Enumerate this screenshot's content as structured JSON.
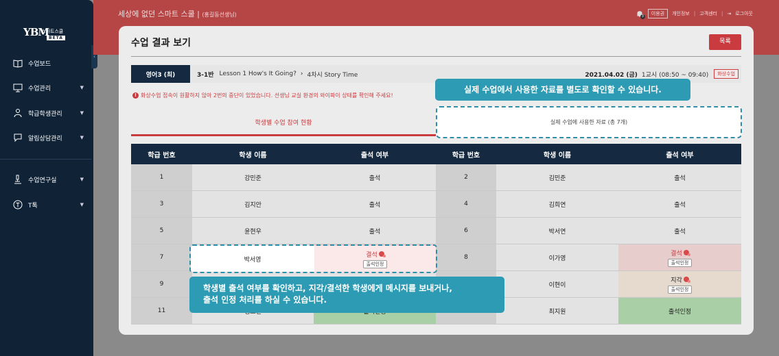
{
  "sidebar": {
    "logo_mark": "YBM",
    "brand": "스마트스쿨",
    "beta": "BETA",
    "collapse_icon": "chevron-left-icon",
    "items": [
      {
        "label": "수업보드",
        "icon": "book-icon",
        "has_arrow": false
      },
      {
        "label": "수업관리",
        "icon": "monitor-icon",
        "has_arrow": true
      },
      {
        "label": "학급학생관리",
        "icon": "users-icon",
        "has_arrow": true
      },
      {
        "label": "알림상담관리",
        "icon": "chat-icon",
        "has_arrow": true
      },
      {
        "label": "수업연구실",
        "icon": "microscope-icon",
        "has_arrow": true
      },
      {
        "label": "T톡",
        "icon": "t-circle-icon",
        "has_arrow": true
      }
    ]
  },
  "topbar": {
    "title": "세상에 없던 스마트 스쿨 |",
    "teacher": "(홍길동선생님)",
    "notif_count": "3",
    "user_button": "이용권",
    "links": [
      "개인정보",
      "고객센터"
    ],
    "logout": "로그아웃"
  },
  "page": {
    "title": "수업 결과 보기",
    "list_button": "목록"
  },
  "classbar": {
    "subject": "영어3 (최)",
    "class": "3-1반",
    "lesson": "Lesson 1 How's It Going?",
    "session": "4차시 Story Time",
    "date": "2021.04.02 (금)",
    "time": "1교시 (08:50 ~ 09:40)",
    "mode": "화상수업"
  },
  "warning": "화상수업 접속이 원활하지 않아 2번의 중단이 있었습니다. 선생님 교실 환경의 와이파이 상태를 확인해 주세요!",
  "tabs": {
    "participation": "학생별 수업 참여 현황",
    "materials": "실제 수업에 사용한 자료 (총 7개)"
  },
  "tips": {
    "materials": "실제 수업에서 사용한 자료를 별도로 확인할 수 있습니다.",
    "attendance_line1": "학생별 출석 여부를 확인하고, 지각/결석한 학생에게 메시지를 보내거나,",
    "attendance_line2": "출석 인정 처리를 하실 수 있습니다."
  },
  "table": {
    "headers": [
      "학급 번호",
      "학생 이름",
      "출석 여부",
      "학급 번호",
      "학생 이름",
      "출석 여부"
    ],
    "approve_label": "출석인정",
    "rows": [
      [
        {
          "num": "1",
          "name": "강민준",
          "att": "출석",
          "state": "present"
        },
        {
          "num": "2",
          "name": "김민준",
          "att": "출석",
          "state": "present"
        }
      ],
      [
        {
          "num": "3",
          "name": "김지안",
          "att": "출석",
          "state": "present"
        },
        {
          "num": "4",
          "name": "김희연",
          "att": "출석",
          "state": "present"
        }
      ],
      [
        {
          "num": "5",
          "name": "윤현우",
          "att": "출석",
          "state": "present"
        },
        {
          "num": "6",
          "name": "박서연",
          "att": "출석",
          "state": "present"
        }
      ],
      [
        {
          "num": "7",
          "name": "박서영",
          "att": "결석",
          "state": "absent"
        },
        {
          "num": "8",
          "name": "이가영",
          "att": "결석",
          "state": "absent"
        }
      ],
      [
        {
          "num": "9",
          "name": "",
          "att": "",
          "state": "hidden"
        },
        {
          "num": "10",
          "name": "이현이",
          "att": "지각",
          "state": "late"
        }
      ],
      [
        {
          "num": "11",
          "name": "정도연",
          "att": "출석인정",
          "state": "approved"
        },
        {
          "num": "12",
          "name": "최지원",
          "att": "출석인정",
          "state": "approved"
        }
      ]
    ]
  }
}
